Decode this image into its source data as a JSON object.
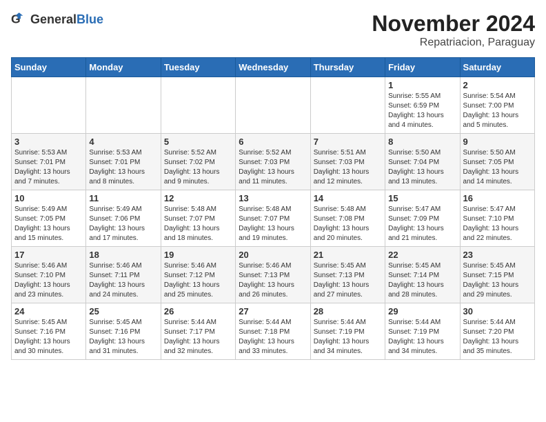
{
  "header": {
    "logo_general": "General",
    "logo_blue": "Blue",
    "month": "November 2024",
    "location": "Repatriacion, Paraguay"
  },
  "days_of_week": [
    "Sunday",
    "Monday",
    "Tuesday",
    "Wednesday",
    "Thursday",
    "Friday",
    "Saturday"
  ],
  "weeks": [
    [
      {
        "day": "",
        "sunrise": "",
        "sunset": "",
        "daylight": ""
      },
      {
        "day": "",
        "sunrise": "",
        "sunset": "",
        "daylight": ""
      },
      {
        "day": "",
        "sunrise": "",
        "sunset": "",
        "daylight": ""
      },
      {
        "day": "",
        "sunrise": "",
        "sunset": "",
        "daylight": ""
      },
      {
        "day": "",
        "sunrise": "",
        "sunset": "",
        "daylight": ""
      },
      {
        "day": "1",
        "sunrise": "Sunrise: 5:55 AM",
        "sunset": "Sunset: 6:59 PM",
        "daylight": "Daylight: 13 hours and 4 minutes."
      },
      {
        "day": "2",
        "sunrise": "Sunrise: 5:54 AM",
        "sunset": "Sunset: 7:00 PM",
        "daylight": "Daylight: 13 hours and 5 minutes."
      }
    ],
    [
      {
        "day": "3",
        "sunrise": "Sunrise: 5:53 AM",
        "sunset": "Sunset: 7:01 PM",
        "daylight": "Daylight: 13 hours and 7 minutes."
      },
      {
        "day": "4",
        "sunrise": "Sunrise: 5:53 AM",
        "sunset": "Sunset: 7:01 PM",
        "daylight": "Daylight: 13 hours and 8 minutes."
      },
      {
        "day": "5",
        "sunrise": "Sunrise: 5:52 AM",
        "sunset": "Sunset: 7:02 PM",
        "daylight": "Daylight: 13 hours and 9 minutes."
      },
      {
        "day": "6",
        "sunrise": "Sunrise: 5:52 AM",
        "sunset": "Sunset: 7:03 PM",
        "daylight": "Daylight: 13 hours and 11 minutes."
      },
      {
        "day": "7",
        "sunrise": "Sunrise: 5:51 AM",
        "sunset": "Sunset: 7:03 PM",
        "daylight": "Daylight: 13 hours and 12 minutes."
      },
      {
        "day": "8",
        "sunrise": "Sunrise: 5:50 AM",
        "sunset": "Sunset: 7:04 PM",
        "daylight": "Daylight: 13 hours and 13 minutes."
      },
      {
        "day": "9",
        "sunrise": "Sunrise: 5:50 AM",
        "sunset": "Sunset: 7:05 PM",
        "daylight": "Daylight: 13 hours and 14 minutes."
      }
    ],
    [
      {
        "day": "10",
        "sunrise": "Sunrise: 5:49 AM",
        "sunset": "Sunset: 7:05 PM",
        "daylight": "Daylight: 13 hours and 15 minutes."
      },
      {
        "day": "11",
        "sunrise": "Sunrise: 5:49 AM",
        "sunset": "Sunset: 7:06 PM",
        "daylight": "Daylight: 13 hours and 17 minutes."
      },
      {
        "day": "12",
        "sunrise": "Sunrise: 5:48 AM",
        "sunset": "Sunset: 7:07 PM",
        "daylight": "Daylight: 13 hours and 18 minutes."
      },
      {
        "day": "13",
        "sunrise": "Sunrise: 5:48 AM",
        "sunset": "Sunset: 7:07 PM",
        "daylight": "Daylight: 13 hours and 19 minutes."
      },
      {
        "day": "14",
        "sunrise": "Sunrise: 5:48 AM",
        "sunset": "Sunset: 7:08 PM",
        "daylight": "Daylight: 13 hours and 20 minutes."
      },
      {
        "day": "15",
        "sunrise": "Sunrise: 5:47 AM",
        "sunset": "Sunset: 7:09 PM",
        "daylight": "Daylight: 13 hours and 21 minutes."
      },
      {
        "day": "16",
        "sunrise": "Sunrise: 5:47 AM",
        "sunset": "Sunset: 7:10 PM",
        "daylight": "Daylight: 13 hours and 22 minutes."
      }
    ],
    [
      {
        "day": "17",
        "sunrise": "Sunrise: 5:46 AM",
        "sunset": "Sunset: 7:10 PM",
        "daylight": "Daylight: 13 hours and 23 minutes."
      },
      {
        "day": "18",
        "sunrise": "Sunrise: 5:46 AM",
        "sunset": "Sunset: 7:11 PM",
        "daylight": "Daylight: 13 hours and 24 minutes."
      },
      {
        "day": "19",
        "sunrise": "Sunrise: 5:46 AM",
        "sunset": "Sunset: 7:12 PM",
        "daylight": "Daylight: 13 hours and 25 minutes."
      },
      {
        "day": "20",
        "sunrise": "Sunrise: 5:46 AM",
        "sunset": "Sunset: 7:13 PM",
        "daylight": "Daylight: 13 hours and 26 minutes."
      },
      {
        "day": "21",
        "sunrise": "Sunrise: 5:45 AM",
        "sunset": "Sunset: 7:13 PM",
        "daylight": "Daylight: 13 hours and 27 minutes."
      },
      {
        "day": "22",
        "sunrise": "Sunrise: 5:45 AM",
        "sunset": "Sunset: 7:14 PM",
        "daylight": "Daylight: 13 hours and 28 minutes."
      },
      {
        "day": "23",
        "sunrise": "Sunrise: 5:45 AM",
        "sunset": "Sunset: 7:15 PM",
        "daylight": "Daylight: 13 hours and 29 minutes."
      }
    ],
    [
      {
        "day": "24",
        "sunrise": "Sunrise: 5:45 AM",
        "sunset": "Sunset: 7:16 PM",
        "daylight": "Daylight: 13 hours and 30 minutes."
      },
      {
        "day": "25",
        "sunrise": "Sunrise: 5:45 AM",
        "sunset": "Sunset: 7:16 PM",
        "daylight": "Daylight: 13 hours and 31 minutes."
      },
      {
        "day": "26",
        "sunrise": "Sunrise: 5:44 AM",
        "sunset": "Sunset: 7:17 PM",
        "daylight": "Daylight: 13 hours and 32 minutes."
      },
      {
        "day": "27",
        "sunrise": "Sunrise: 5:44 AM",
        "sunset": "Sunset: 7:18 PM",
        "daylight": "Daylight: 13 hours and 33 minutes."
      },
      {
        "day": "28",
        "sunrise": "Sunrise: 5:44 AM",
        "sunset": "Sunset: 7:19 PM",
        "daylight": "Daylight: 13 hours and 34 minutes."
      },
      {
        "day": "29",
        "sunrise": "Sunrise: 5:44 AM",
        "sunset": "Sunset: 7:19 PM",
        "daylight": "Daylight: 13 hours and 34 minutes."
      },
      {
        "day": "30",
        "sunrise": "Sunrise: 5:44 AM",
        "sunset": "Sunset: 7:20 PM",
        "daylight": "Daylight: 13 hours and 35 minutes."
      }
    ]
  ]
}
